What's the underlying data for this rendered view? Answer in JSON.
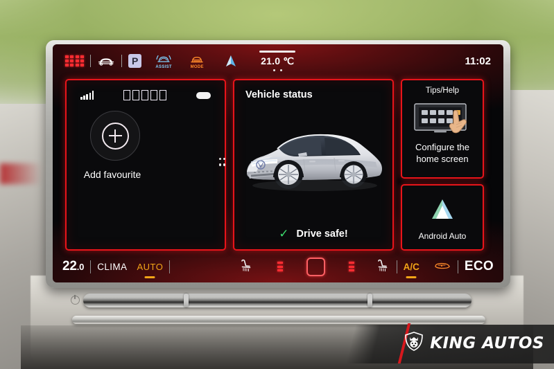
{
  "statusbar": {
    "apps_icon": "grid-apps-icon",
    "car_icon": "car-front-icon",
    "park_label": "P",
    "assist_label": "ASSIST",
    "mode_label": "MODE",
    "nav_icon": "navigation-arrow-icon",
    "temperature": "21.0 ℃",
    "clock": "11:02"
  },
  "favourite_tile": {
    "signal_icon": "signal-bars-icon",
    "placeholder_glyphs": "□□□□□",
    "battery_icon": "battery-icon",
    "add_icon": "plus-circle-icon",
    "label": "Add favourite"
  },
  "vehicle_status_tile": {
    "title": "Vehicle status",
    "car_image": "vw-id5-suv-render",
    "check_icon": "✓",
    "status_text": "Drive safe!"
  },
  "tips_tile": {
    "title": "Tips/Help",
    "image": "configure-home-screen-illustration",
    "caption_line1": "Configure the",
    "caption_line2": "home screen"
  },
  "android_auto_tile": {
    "logo": "android-auto-icon",
    "label": "Android Auto"
  },
  "bottombar": {
    "temp_int": "22",
    "temp_dec": ".0",
    "clima_label": "CLIMA",
    "auto_label": "AUTO",
    "seat_left_icon": "seat-heater-left-icon",
    "fan_left_icon": "fan-level-left-icon",
    "sync_icon": "sync-square-icon",
    "fan_right_icon": "fan-level-right-icon",
    "seat_right_icon": "seat-heater-right-icon",
    "ac_label": "A/C",
    "defrost_icon": "rear-defrost-icon",
    "eco_label": "ECO"
  },
  "watermark": {
    "text": "KING AUTOS",
    "logo": "king-autos-shield-icon",
    "accent_color": "#d8181d"
  },
  "theme": {
    "tile_border": "#e8141a",
    "accent_orange": "#f2a517",
    "accent_green": "#3cdc6e",
    "screen_bg": "#060608"
  }
}
